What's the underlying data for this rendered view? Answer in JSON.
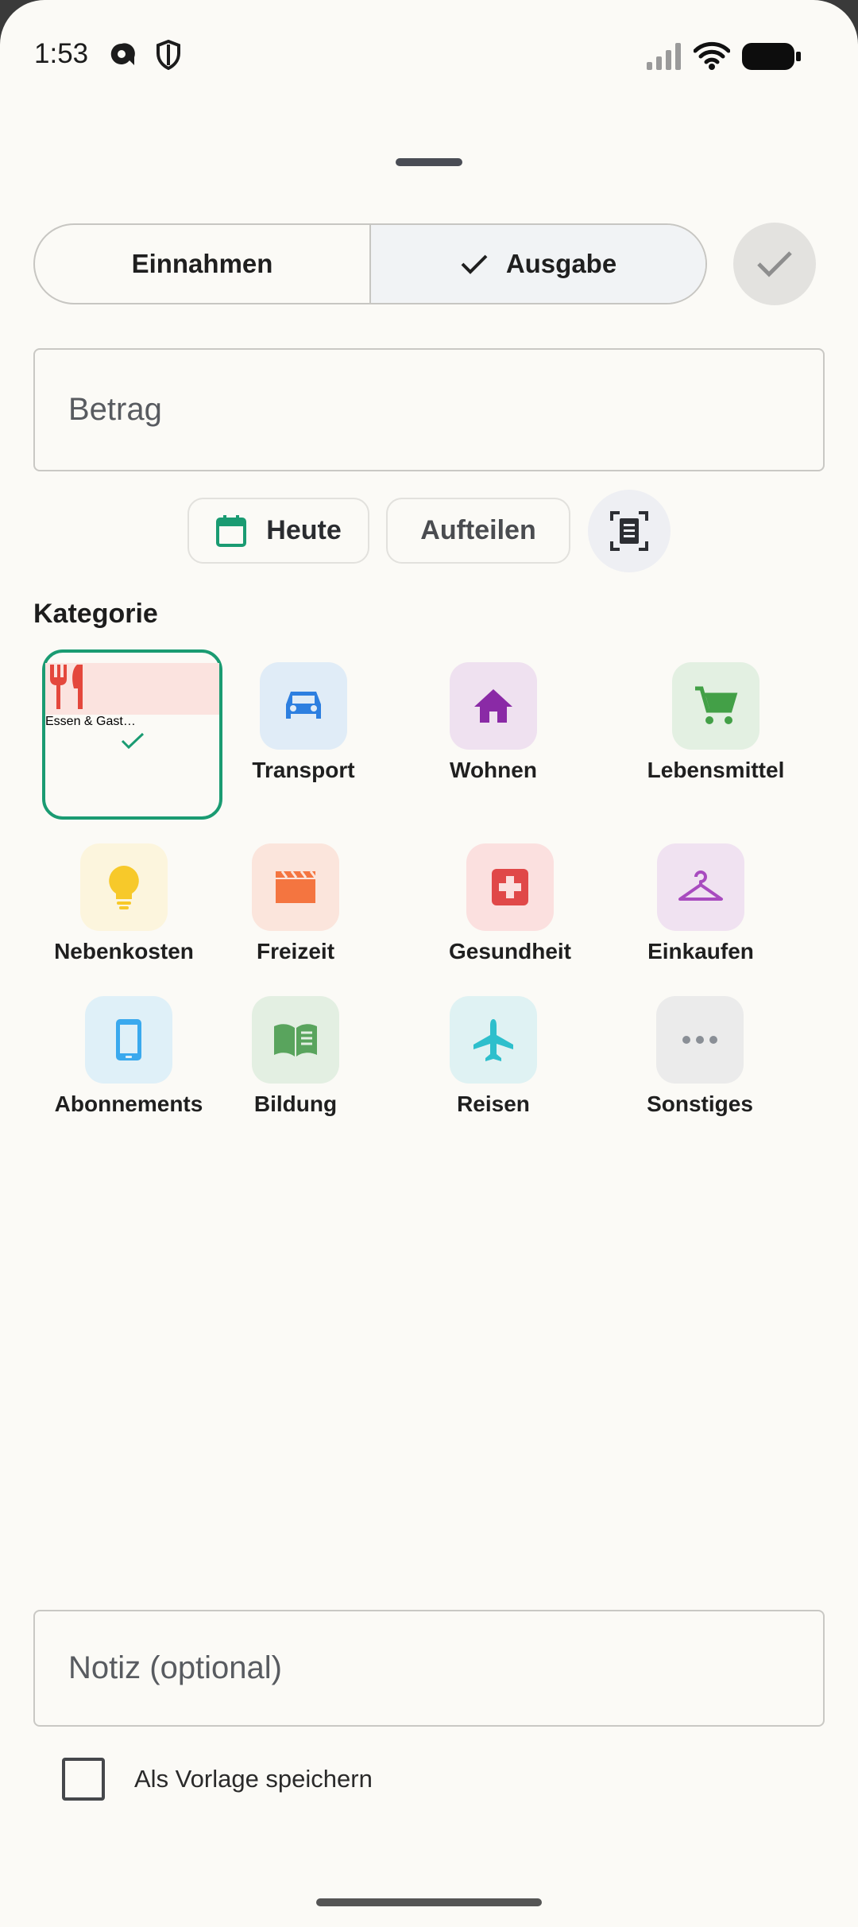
{
  "status_bar": {
    "time": "1:53"
  },
  "toggle": {
    "income_label": "Einnahmen",
    "expense_label": "Ausgabe",
    "selected": "expense"
  },
  "amount": {
    "placeholder": "Betrag"
  },
  "chips": {
    "date_label": "Heute",
    "split_label": "Aufteilen"
  },
  "category": {
    "title": "Kategorie",
    "selected": "Essen & Gast…",
    "items": [
      {
        "label": "Essen & Gast…",
        "icon": "restaurant-icon",
        "color": "#e4473c",
        "bg": "#fbe3df"
      },
      {
        "label": "Transport",
        "icon": "car-icon",
        "color": "#2d7fe0",
        "bg": "#e0ecf7"
      },
      {
        "label": "Wohnen",
        "icon": "home-icon",
        "color": "#8a2aa6",
        "bg": "#efe1f0"
      },
      {
        "label": "Lebensmittel",
        "icon": "cart-icon",
        "color": "#43a047",
        "bg": "#e3f0e2"
      },
      {
        "label": "Nebenkosten",
        "icon": "lightbulb-icon",
        "color": "#f7c92a",
        "bg": "#fcf5dd"
      },
      {
        "label": "Freizeit",
        "icon": "movie-icon",
        "color": "#f47540",
        "bg": "#fbe5dc"
      },
      {
        "label": "Gesundheit",
        "icon": "medical-icon",
        "color": "#e04848",
        "bg": "#fbe0df"
      },
      {
        "label": "Einkaufen",
        "icon": "hanger-icon",
        "color": "#a84bbf",
        "bg": "#f0e2f1"
      },
      {
        "label": "Abonnements",
        "icon": "phone-icon",
        "color": "#3aa9ee",
        "bg": "#dff0f8"
      },
      {
        "label": "Bildung",
        "icon": "book-icon",
        "color": "#59a45d",
        "bg": "#e3efe2"
      },
      {
        "label": "Reisen",
        "icon": "airplane-icon",
        "color": "#2ebfcc",
        "bg": "#dff2f3"
      },
      {
        "label": "Sonstiges",
        "icon": "more-icon",
        "color": "#8a8f96",
        "bg": "#ebebeb"
      }
    ]
  },
  "note": {
    "placeholder": "Notiz (optional)"
  },
  "template_checkbox": {
    "label": "Als Vorlage speichern",
    "checked": false
  }
}
